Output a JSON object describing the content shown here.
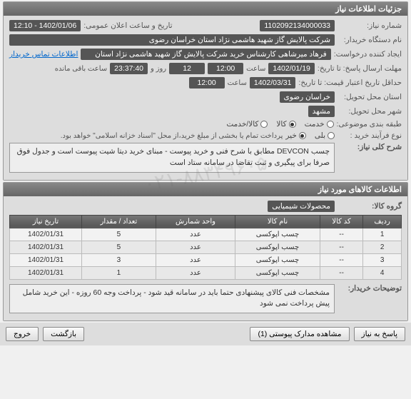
{
  "panel1": {
    "title": "جزئیات اطلاعات نیاز",
    "need_no_label": "شماره نیاز:",
    "need_no": "1102092134000033",
    "announce_label": "تاریخ و ساعت اعلان عمومی:",
    "announce_value": "1402/01/06 - 12:10",
    "buyer_label": "نام دستگاه خریدار:",
    "buyer": "شرکت پالایش گاز شهید هاشمی نژاد   استان خراسان رضوی",
    "creator_label": "ایجاد کننده درخواست:",
    "creator": "فرهاد میرشاهی کارشناس خرید شرکت پالایش گاز شهید هاشمی نژاد   استان",
    "creator_contact": "اطلاعات تماس خریدار",
    "deadline_label": "مهلت ارسال پاسخ:  تا تاریخ:",
    "deadline_date": "1402/01/19",
    "time_label": "ساعت",
    "deadline_time": "12:00",
    "day_label": "روز و",
    "hour_label": "ساعت باقی مانده",
    "days_left": "12",
    "time_left": "23:37:40",
    "validity_label": "حداقل تاریخ اعتبار قیمت: تا تاریخ:",
    "validity_date": "1402/03/31",
    "validity_time": "12:00",
    "province_label": "استان محل تحویل:",
    "province": "خراسان رضوی",
    "city_label": "شهر محل تحویل:",
    "city": "مشهد",
    "category_label": "طبقه بندی موضوعی:",
    "cat_service": "خدمت",
    "cat_goods": "کالا",
    "cat_both": "کالا/خدمت",
    "process_label": "نوع فرآیند خرید :",
    "process1": "بلی",
    "process2": "خیر",
    "process_note": "پرداخت تمام یا بخشی از مبلغ خرید،از محل \"اسناد خزانه اسلامی\" خواهد بود.",
    "desc_label": "شرح کلی نیاز:",
    "desc": "چسب DEVCON مطابق با شرح فنی و خرید پیوست - مبنای خرید دیتا شیت پیوست است و جدول فوق صرفا برای پیگیری و ثبت تقاضا در سامانه ستاد است"
  },
  "panel2": {
    "title": "اطلاعات کالاهای مورد نیاز",
    "group_label": "گروه کالا:",
    "group": "محصولات شیمیایی",
    "cols": {
      "row": "ردیف",
      "code": "کد کالا",
      "name": "نام کالا",
      "unit": "واحد شمارش",
      "qty": "تعداد / مقدار",
      "date": "تاریخ نیاز"
    },
    "rows": [
      {
        "n": "1",
        "code": "--",
        "name": "چسب اپوکسی",
        "unit": "عدد",
        "qty": "5",
        "date": "1402/01/31"
      },
      {
        "n": "2",
        "code": "--",
        "name": "چسب اپوکسی",
        "unit": "عدد",
        "qty": "5",
        "date": "1402/01/31"
      },
      {
        "n": "3",
        "code": "--",
        "name": "چسب اپوکسی",
        "unit": "عدد",
        "qty": "3",
        "date": "1402/01/31"
      },
      {
        "n": "4",
        "code": "--",
        "name": "چسب اپوکسی",
        "unit": "عدد",
        "qty": "1",
        "date": "1402/01/31"
      }
    ],
    "notes_label": "توضیحات خریدار:",
    "notes": "مشخصات فنی کالای پیشنهادی حتما باید در سامانه قید شود - پرداخت وجه 60 روزه - این خرید شامل پیش پرداخت نمی شود"
  },
  "footer": {
    "respond": "پاسخ به نیاز",
    "attachments": "مشاهده مدارک پیوستی (1)",
    "back": "بازگشت",
    "exit": "خروج"
  },
  "watermark": "۰۲۱-۸۸۳۴۹۶۰۵"
}
